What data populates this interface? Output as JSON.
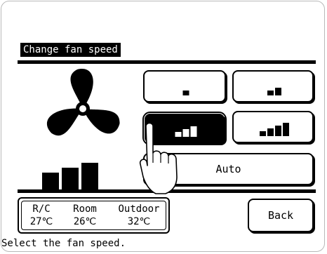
{
  "screen": {
    "title": "Change fan speed",
    "message": "Select the fan speed."
  },
  "fan_speed": {
    "current_level": 3,
    "max_level": 4,
    "options": [
      {
        "id": "speed-1",
        "level": 1,
        "bars": 1
      },
      {
        "id": "speed-2",
        "level": 2,
        "bars": 2
      },
      {
        "id": "speed-3",
        "level": 3,
        "bars": 3
      },
      {
        "id": "speed-4",
        "level": 4,
        "bars": 4
      }
    ],
    "auto_label": "Auto",
    "selected": "speed-3"
  },
  "status": {
    "columns": [
      {
        "header": "R/C",
        "value": "27℃"
      },
      {
        "header": "Room",
        "value": "26℃"
      },
      {
        "header": "Outdoor",
        "value": "32℃"
      }
    ]
  },
  "buttons": {
    "back_label": "Back"
  },
  "icons": {
    "fan": "fan-icon",
    "pointer": "pointing-hand-icon"
  },
  "colors": {
    "foreground": "#000000",
    "background": "#ffffff"
  }
}
